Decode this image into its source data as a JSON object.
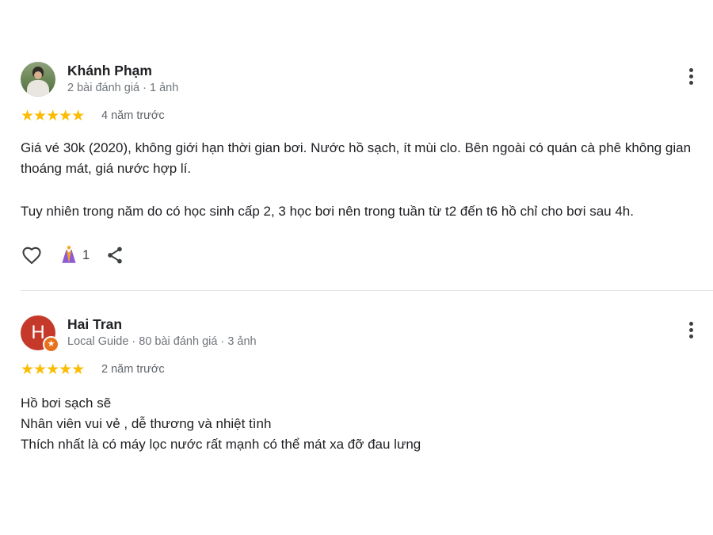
{
  "reviews": [
    {
      "author": "Khánh Phạm",
      "meta": "2 bài đánh giá · 1 ảnh",
      "stars": "★★★★★",
      "time": "4 năm trước",
      "paragraphs": [
        "Giá vé 30k (2020), không giới hạn thời gian bơi. Nước hồ sạch, ít mùi clo. Bên ngoài có quán cà phê không gian thoáng mát, giá nước hợp lí.",
        "Tuy nhiên trong năm do có học sinh cấp 2, 3 học bơi nên trong tuần từ t2 đến t6 hồ chỉ cho bơi sau 4h."
      ],
      "reaction_count": "1",
      "avatar": "photo"
    },
    {
      "author": "Hai Tran",
      "meta": "Local Guide · 80 bài đánh giá · 3 ảnh",
      "stars": "★★★★★",
      "time": "2 năm trước",
      "lines": [
        "Hồ bơi sạch sẽ",
        "Nhân viên vui vẻ , dễ thương và nhiệt tình",
        "Thích nhất là có máy lọc nước rất mạnh có thể mát xa đỡ đau lưng"
      ],
      "avatar_letter": "H",
      "avatar_color": "#c5392a"
    }
  ],
  "icons": {
    "more": "more-vert-icon",
    "like": "heart-outline-icon",
    "reaction": "clapping-hands-icon",
    "share": "share-icon",
    "local_guide": "local-guide-star-badge-icon"
  },
  "colors": {
    "star": "#fbbc04",
    "meta_text": "#70757a",
    "local_guide_badge": "#e8711c"
  }
}
